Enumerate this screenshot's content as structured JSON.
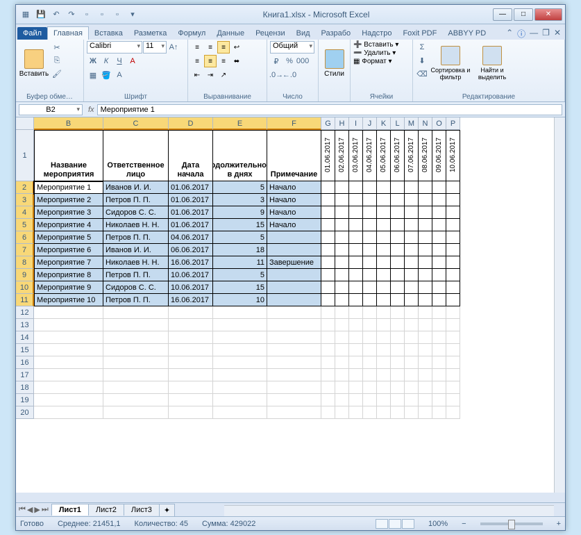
{
  "window": {
    "title": "Книга1.xlsx - Microsoft Excel"
  },
  "ribbon": {
    "tabs": {
      "file": "Файл",
      "home": "Главная",
      "insert": "Вставка",
      "layout": "Разметка",
      "formulas": "Формул",
      "data": "Данные",
      "review": "Рецензи",
      "view": "Вид",
      "developer": "Разрабо",
      "addins": "Надстро",
      "foxit": "Foxit PDF",
      "abbyy": "ABBYY PD"
    },
    "groups": {
      "clipboard": "Буфер обме…",
      "paste": "Вставить",
      "font": "Шрифт",
      "font_name": "Calibri",
      "font_size": "11",
      "alignment": "Выравнивание",
      "number": "Число",
      "number_format": "Общий",
      "styles": "Стили",
      "cells": "Ячейки",
      "insert_btn": "Вставить",
      "delete_btn": "Удалить",
      "format_btn": "Формат",
      "editing": "Редактирование",
      "sort": "Сортировка и фильтр",
      "find": "Найти и выделить"
    }
  },
  "namebox": "B2",
  "formula": "Мероприятие 1",
  "fx": "fx",
  "columns": {
    "B": "B",
    "C": "C",
    "D": "D",
    "E": "E",
    "F": "F",
    "G": "G",
    "H": "H",
    "I": "I",
    "J": "J",
    "K": "K",
    "L": "L",
    "M": "M",
    "N": "N",
    "O": "O",
    "P": "P"
  },
  "headers": {
    "name": "Название мероприятия",
    "responsible": "Ответственное лицо",
    "start": "Дата начала",
    "duration": "Продолжительность в днях",
    "note": "Примечание"
  },
  "dates": [
    "01.06.2017",
    "02.06.2017",
    "03.06.2017",
    "04.06.2017",
    "05.06.2017",
    "06.06.2017",
    "07.06.2017",
    "08.06.2017",
    "09.06.2017",
    "10.06.2017"
  ],
  "rows": [
    {
      "n": "Мероприятие 1",
      "r": "Иванов И. И.",
      "d": "01.06.2017",
      "dur": "5",
      "note": "Начало"
    },
    {
      "n": "Мероприятие 2",
      "r": "Петров П. П.",
      "d": "01.06.2017",
      "dur": "3",
      "note": "Начало"
    },
    {
      "n": "Мероприятие 3",
      "r": "Сидоров С. С.",
      "d": "01.06.2017",
      "dur": "9",
      "note": "Начало"
    },
    {
      "n": "Мероприятие 4",
      "r": "Николаев Н. Н.",
      "d": "01.06.2017",
      "dur": "15",
      "note": "Начало"
    },
    {
      "n": "Мероприятие 5",
      "r": "Петров П. П.",
      "d": "04.06.2017",
      "dur": "5",
      "note": ""
    },
    {
      "n": "Мероприятие 6",
      "r": "Иванов И. И.",
      "d": "06.06.2017",
      "dur": "18",
      "note": ""
    },
    {
      "n": "Мероприятие 7",
      "r": "Николаев Н. Н.",
      "d": "16.06.2017",
      "dur": "11",
      "note": "Завершение"
    },
    {
      "n": "Мероприятие 8",
      "r": "Петров П. П.",
      "d": "10.06.2017",
      "dur": "5",
      "note": ""
    },
    {
      "n": "Мероприятие 9",
      "r": "Сидоров С. С.",
      "d": "10.06.2017",
      "dur": "15",
      "note": ""
    },
    {
      "n": "Мероприятие 10",
      "r": "Петров П. П.",
      "d": "16.06.2017",
      "dur": "10",
      "note": ""
    }
  ],
  "sheets": {
    "s1": "Лист1",
    "s2": "Лист2",
    "s3": "Лист3"
  },
  "status": {
    "ready": "Готово",
    "avg_label": "Среднее:",
    "avg": "21451,1",
    "count_label": "Количество:",
    "count": "45",
    "sum_label": "Сумма:",
    "sum": "429022",
    "zoom": "100%"
  },
  "colwidths": {
    "B": 100,
    "C": 94,
    "D": 64,
    "E": 78,
    "F": 78,
    "narrow": 20
  }
}
